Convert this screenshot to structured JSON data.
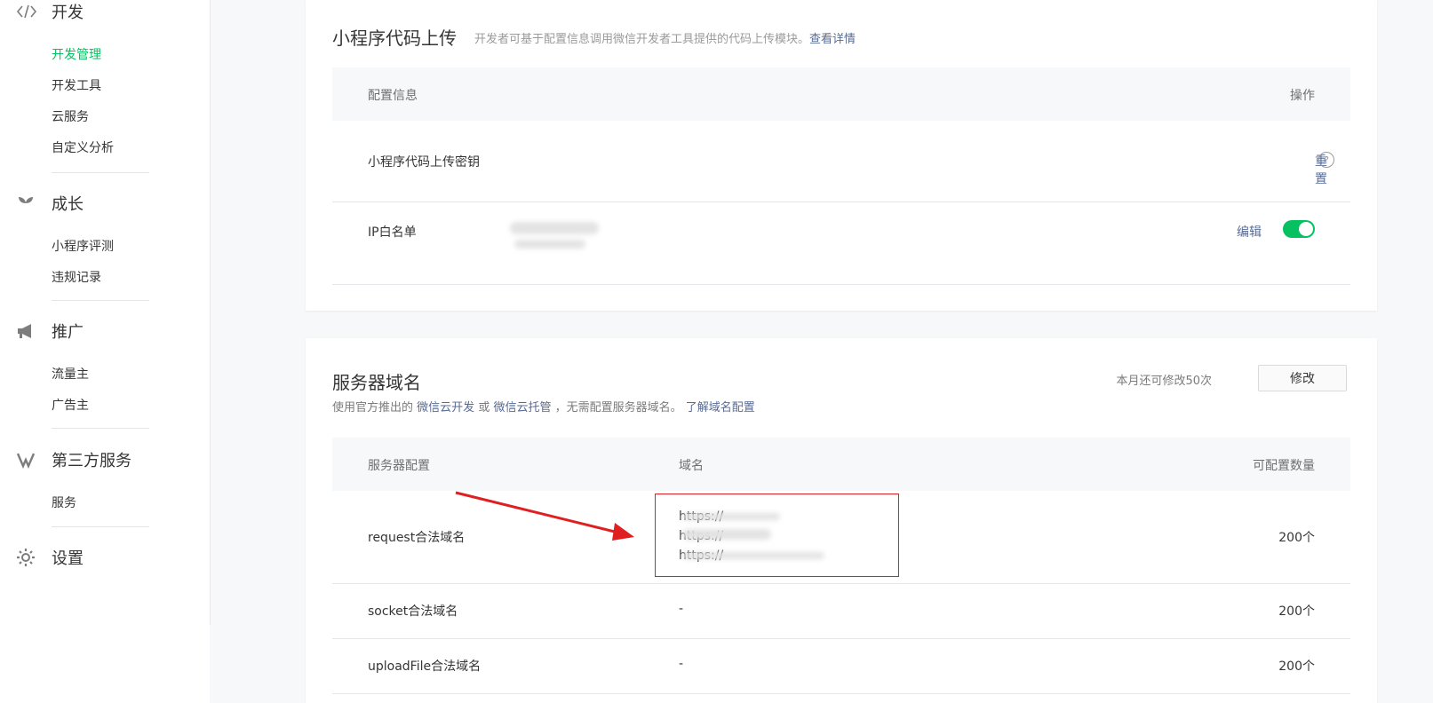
{
  "sidebar": {
    "sections": [
      {
        "title": "开发",
        "icon": "code-icon",
        "items": [
          "开发管理",
          "开发工具",
          "云服务",
          "自定义分析"
        ]
      },
      {
        "title": "成长",
        "icon": "sprout-icon",
        "items": [
          "小程序评测",
          "违规记录"
        ]
      },
      {
        "title": "推广",
        "icon": "megaphone-icon",
        "items": [
          "流量主",
          "广告主"
        ]
      },
      {
        "title": "第三方服务",
        "icon": "third-party-icon",
        "items": [
          "服务"
        ]
      },
      {
        "title": "设置",
        "icon": "gear-icon",
        "items": []
      }
    ],
    "active_item": "开发管理"
  },
  "upload_card": {
    "title": "小程序代码上传",
    "desc": "开发者可基于配置信息调用微信开发者工具提供的代码上传模块。",
    "desc_link": "查看详情",
    "col_config": "配置信息",
    "col_action": "操作",
    "rows": [
      {
        "label": "小程序代码上传密钥",
        "action": "重置",
        "help": "?"
      },
      {
        "label": "IP白名单",
        "action": "编辑",
        "toggle_on": true
      }
    ]
  },
  "domain_card": {
    "title": "服务器域名",
    "desc_prefix": "使用官方推出的",
    "link1": "微信云开发",
    "desc_or": "或",
    "link2": "微信云托管",
    "desc_suffix": "，无需配置服务器域名。",
    "link3": "了解域名配置",
    "remaining": "本月还可修改50次",
    "modify_button": "修改",
    "col_config": "服务器配置",
    "col_domain": "域名",
    "col_count": "可配置数量",
    "rows": [
      {
        "name": "request合法域名",
        "domains": [
          "https://",
          "https://",
          "https://"
        ],
        "count": "200个"
      },
      {
        "name": "socket合法域名",
        "domains": [
          "-"
        ],
        "count": "200个"
      },
      {
        "name": "uploadFile合法域名",
        "domains": [
          "-"
        ],
        "count": "200个"
      }
    ]
  },
  "colors": {
    "accent": "#07c160",
    "link": "#576b95",
    "highlight_box": "#e02020"
  }
}
